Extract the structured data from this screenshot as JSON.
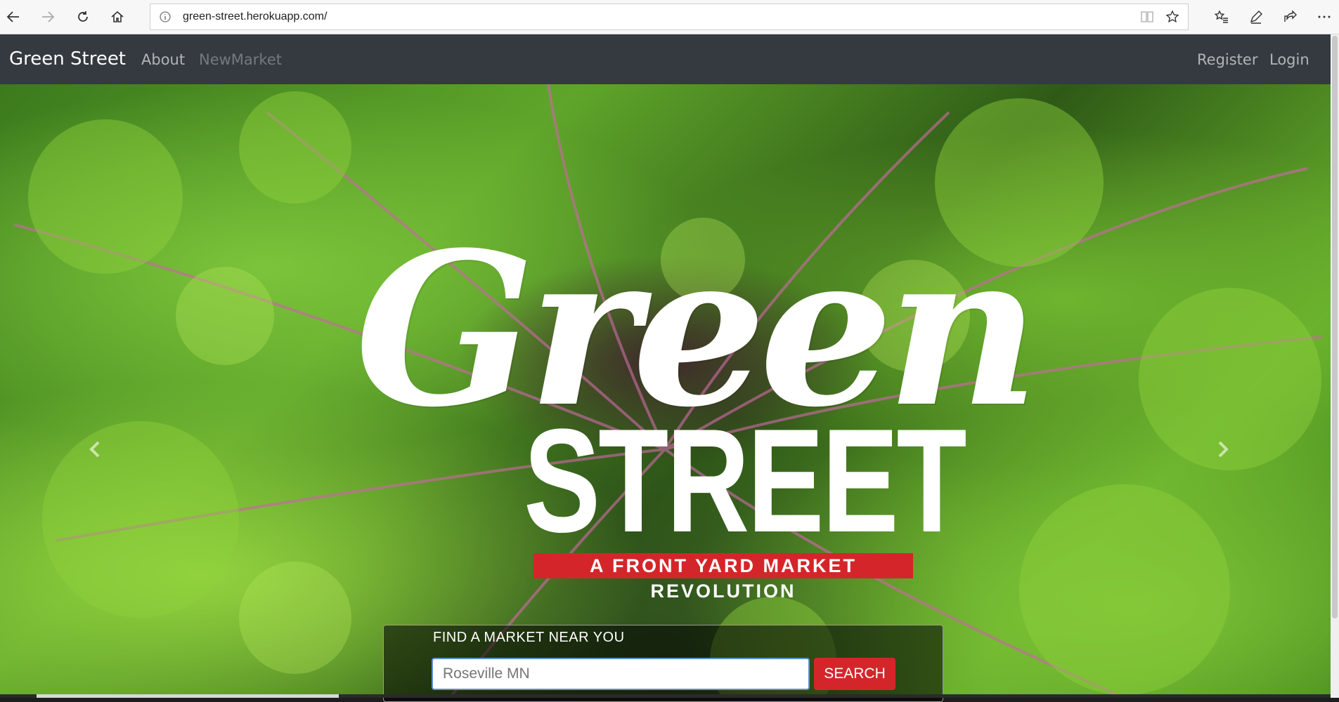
{
  "browser": {
    "url": "green-street.herokuapp.com/",
    "back_icon": "back-arrow-icon",
    "forward_icon": "forward-arrow-icon",
    "refresh_icon": "refresh-icon",
    "home_icon": "home-icon",
    "info_icon": "info-icon",
    "reading_view_icon": "reading-view-icon",
    "favorite_icon": "star-icon",
    "favorites_icon": "favorites-list-icon",
    "notes_icon": "pen-icon",
    "share_icon": "share-icon",
    "more_icon": "more-icon"
  },
  "navbar": {
    "brand": "Green Street",
    "links": [
      {
        "label": "About"
      },
      {
        "label": "NewMarket"
      }
    ],
    "right_links": [
      {
        "label": "Register"
      },
      {
        "label": "Login"
      }
    ]
  },
  "hero": {
    "logo_top": "Green",
    "logo_bottom": "STREET",
    "tagline": "A FRONT YARD MARKET REVOLUTION",
    "prev_icon": "chevron-left-icon",
    "next_icon": "chevron-right-icon"
  },
  "search": {
    "label": "FIND A MARKET NEAR YOU",
    "placeholder": "Roseville MN",
    "button_label": "SEARCH"
  },
  "colors": {
    "navbar_bg": "#343a40",
    "accent_red": "#d4262a",
    "input_border": "#5c8fd6"
  }
}
